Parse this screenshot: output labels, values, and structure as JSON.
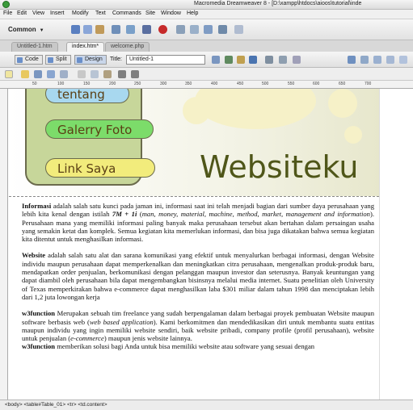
{
  "app": {
    "title": "Macromedia Dreamweaver 8 - [D:\\xampp\\htdocs\\aioos\\tutorial\\inde"
  },
  "menu": [
    "File",
    "Edit",
    "View",
    "Insert",
    "Modify",
    "Text",
    "Commands",
    "Site",
    "Window",
    "Help"
  ],
  "insert_bar": {
    "category": "Common"
  },
  "doc_tabs": [
    "Untitled-1.htm",
    "index.htm*",
    "welcome.php"
  ],
  "view_buttons": [
    "Code",
    "Split",
    "Design"
  ],
  "title_field": {
    "label": "Title:",
    "value": "Untitled-1"
  },
  "ruler_marks": [
    "50",
    "100",
    "150",
    "200",
    "250",
    "300",
    "350",
    "400",
    "450",
    "500",
    "550",
    "600",
    "650",
    "700"
  ],
  "banner": {
    "nav": [
      "tentang",
      "Galerry Foto",
      "Link Saya"
    ],
    "brand": "Websiteku"
  },
  "content": {
    "p1": {
      "b": "Informasi",
      "t1": " adalah salah satu kunci pada jaman ini, informasi saat ini telah menjadi bagian dari sumber daya perusahaan yang lebih kita kenal dengan istilah ",
      "bi": "7M + 1i",
      "t2": " (",
      "i": "man, money, material, machine, method, market, management and information",
      "t3": "). Perusahaan mana yang memiliki informasi paling banyak maka perusahaan tersebut akan bertahan dalam persaingan usaha yang semakin ketat dan komplek. Semua kegiatan kita memerlukan informasi, dan bisa juga dikatakan bahwa semua kegiatan kita ditentut untuk menghasilkan informasi."
    },
    "p2": {
      "b": "Website",
      "t1": " adalah salah satu alat dan sarana komunikasi yang efektif untuk menyalurkan berbagai informasi, dengan Website individu maupun perusahaan dapat memperkenalkan dan meningkatkan citra perusahaan, mengenalkan produk-produk baru, mendapatkan order penjualan, berkomunikasi dengan pelanggan maupun investor dan seterusnya. Banyak keuntungan yang dapat diambil oleh perusahaan bila dapat mengembangkan bisinsnya melalui media internet. Suatu penelitian oleh University of Texas memperkirakan bahwa e-commerce dapat menghasilkan laba $301 miliar dalam tahun 1998 dan menciptakan lebih dari 1,2 juta lowongan kerja"
    },
    "p3": {
      "b1": "w3function",
      "t1": " Merupakan sebuah tim freelance yang sudah berpengalaman dalam berbagai proyek pembuatan Website maupun software berbasis web (",
      "i1": "web based application",
      "t2": "). Kami berkomitmen dan mendedikasikan diri untuk membantu suatu entitas maupun individu yang ingin memiliki website sendiri, baik website pribadi, company profile (profil perusahaan), website untuk penjualan (",
      "i2": "e-commerce",
      "t3": ") maupun jenis website lainnya.",
      "b2": "w3function",
      "t4": " memberikan solusi bagi Anda untuk bisa memiliki website atau software yang sesuai dengan"
    }
  },
  "status": {
    "tag_selector": "<body> <table#Table_01> <tr> <td.content>"
  }
}
